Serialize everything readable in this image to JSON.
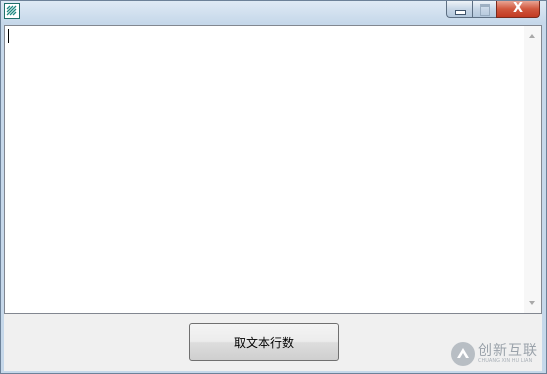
{
  "window": {
    "title": "",
    "icon": "app-icon",
    "close_glyph": "X"
  },
  "editor": {
    "value": ""
  },
  "button": {
    "label": "取文本行数"
  },
  "watermark": {
    "text": "创新互联",
    "subtext": "CHUANG XIN HU LIAN"
  },
  "colors": {
    "title_frame": "#c6d8ea",
    "close_button": "#c94a33",
    "client_background": "#f0f0f0",
    "button_face": "#e5e5e5"
  }
}
